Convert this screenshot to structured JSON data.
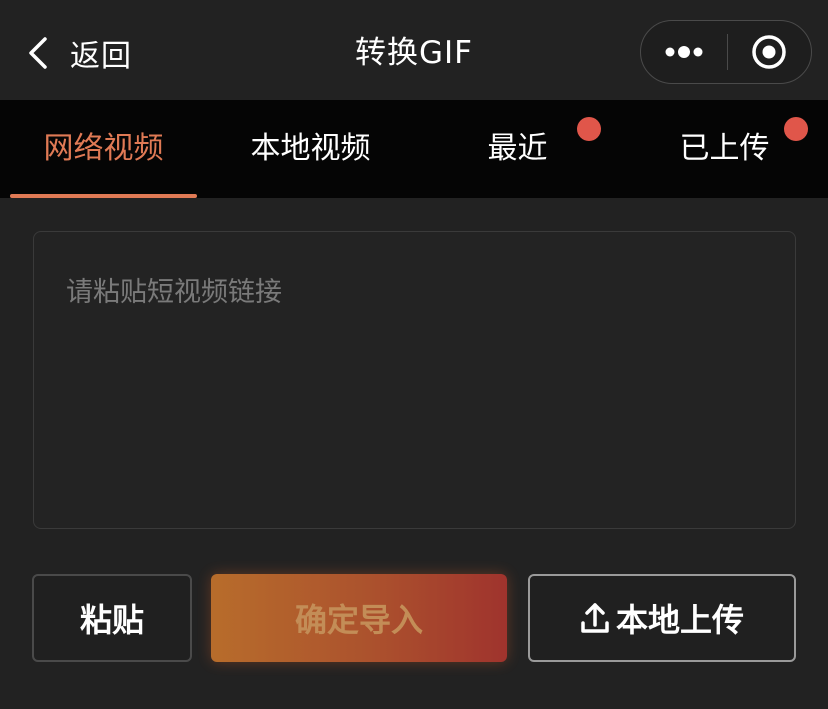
{
  "nav": {
    "back_label": "返回",
    "title": "转换GIF",
    "capsule": {
      "more_icon": "more-dots-icon",
      "close_icon": "target-circle-icon"
    }
  },
  "tabs": [
    {
      "label": "网络视频",
      "active": true,
      "badge": false
    },
    {
      "label": "本地视频",
      "active": false,
      "badge": false
    },
    {
      "label": "最近",
      "active": false,
      "badge": true
    },
    {
      "label": "已上传",
      "active": false,
      "badge": true
    }
  ],
  "link_input": {
    "placeholder": "请粘贴短视频链接",
    "value": ""
  },
  "buttons": {
    "paste": "粘贴",
    "import": "确定导入",
    "upload": "本地上传"
  },
  "colors": {
    "background": "#222222",
    "tab_bar": "#050505",
    "accent": "#e07a55",
    "badge": "#e0564a",
    "import_gradient_start": "#d27a2d",
    "import_gradient_end": "#b6372f"
  }
}
